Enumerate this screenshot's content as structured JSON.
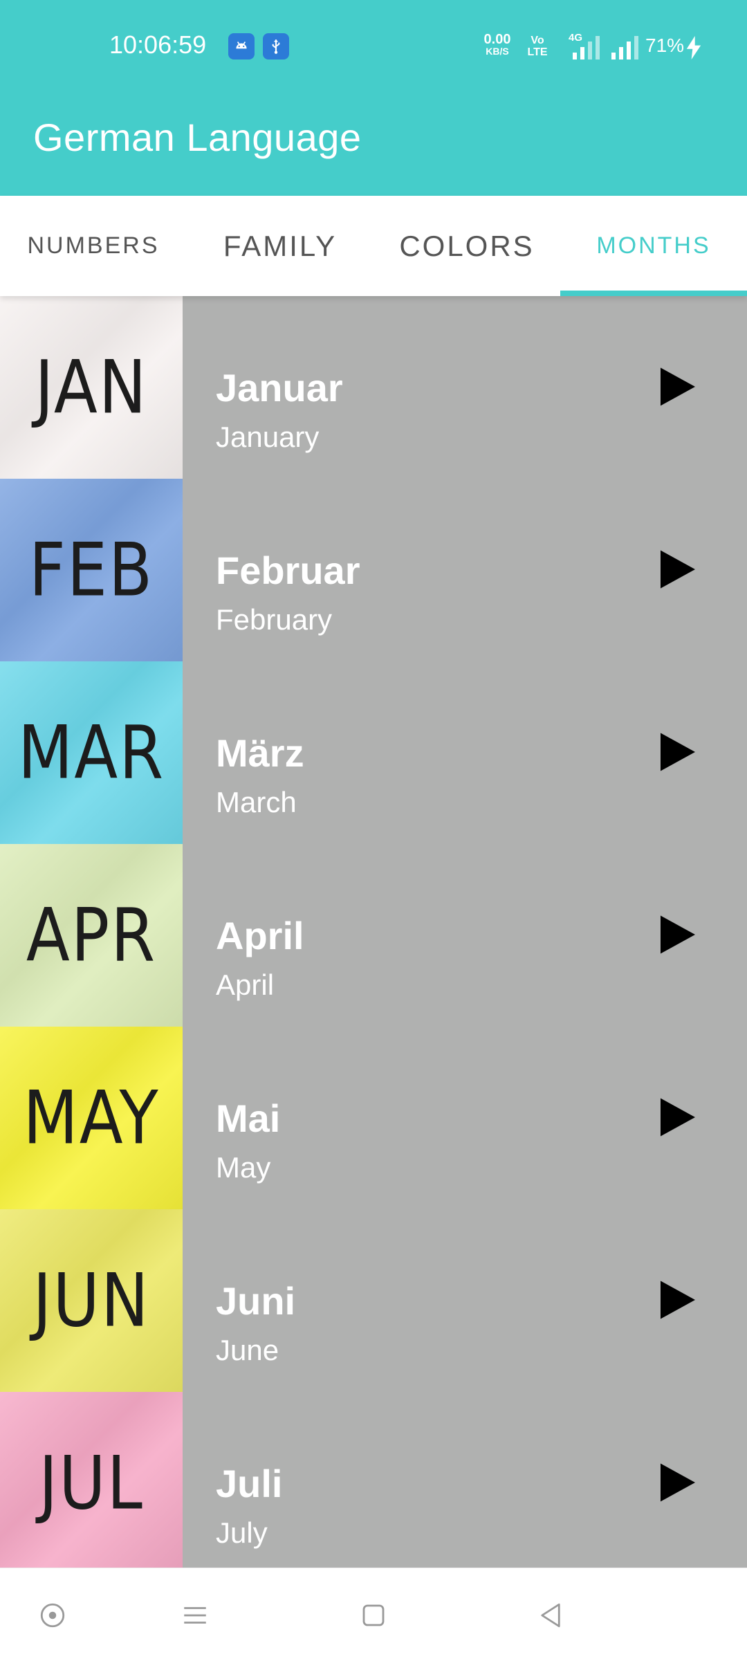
{
  "status_bar": {
    "time": "10:06:59",
    "net_speed": "0.00",
    "net_unit": "KB/S",
    "volte": "Vo LTE",
    "network": "4G",
    "battery": "71%"
  },
  "app_bar": {
    "title": "German Language"
  },
  "tabs": [
    {
      "label": "NUMBERS"
    },
    {
      "label": "FAMILY"
    },
    {
      "label": "COLORS"
    },
    {
      "label": "MONTHS"
    }
  ],
  "months": [
    {
      "thumb": "JAN",
      "german": "Januar",
      "english": "January",
      "color": "#f6f1f0"
    },
    {
      "thumb": "FEB",
      "german": "Februar",
      "english": "February",
      "color": "#7da4e0"
    },
    {
      "thumb": "MAR",
      "german": "März",
      "english": "March",
      "color": "#6cd8ea"
    },
    {
      "thumb": "APR",
      "german": "April",
      "english": "April",
      "color": "#dcecb8"
    },
    {
      "thumb": "MAY",
      "german": "Mai",
      "english": "May",
      "color": "#f7f23a"
    },
    {
      "thumb": "JUN",
      "german": "Juni",
      "english": "June",
      "color": "#ece865"
    },
    {
      "thumb": "JUL",
      "german": "Juli",
      "english": "July",
      "color": "#f6a9c6"
    }
  ],
  "icons": {
    "status": [
      "android-icon",
      "usb-icon",
      "signal-icon",
      "battery-charging-icon"
    ],
    "row_action": "play-icon",
    "nav": [
      "home-dot-icon",
      "menu-icon",
      "square-icon",
      "back-icon"
    ]
  },
  "colors": {
    "accent": "#45cdca",
    "list_bg": "#b0b1b0",
    "tab_text": "#555555"
  }
}
